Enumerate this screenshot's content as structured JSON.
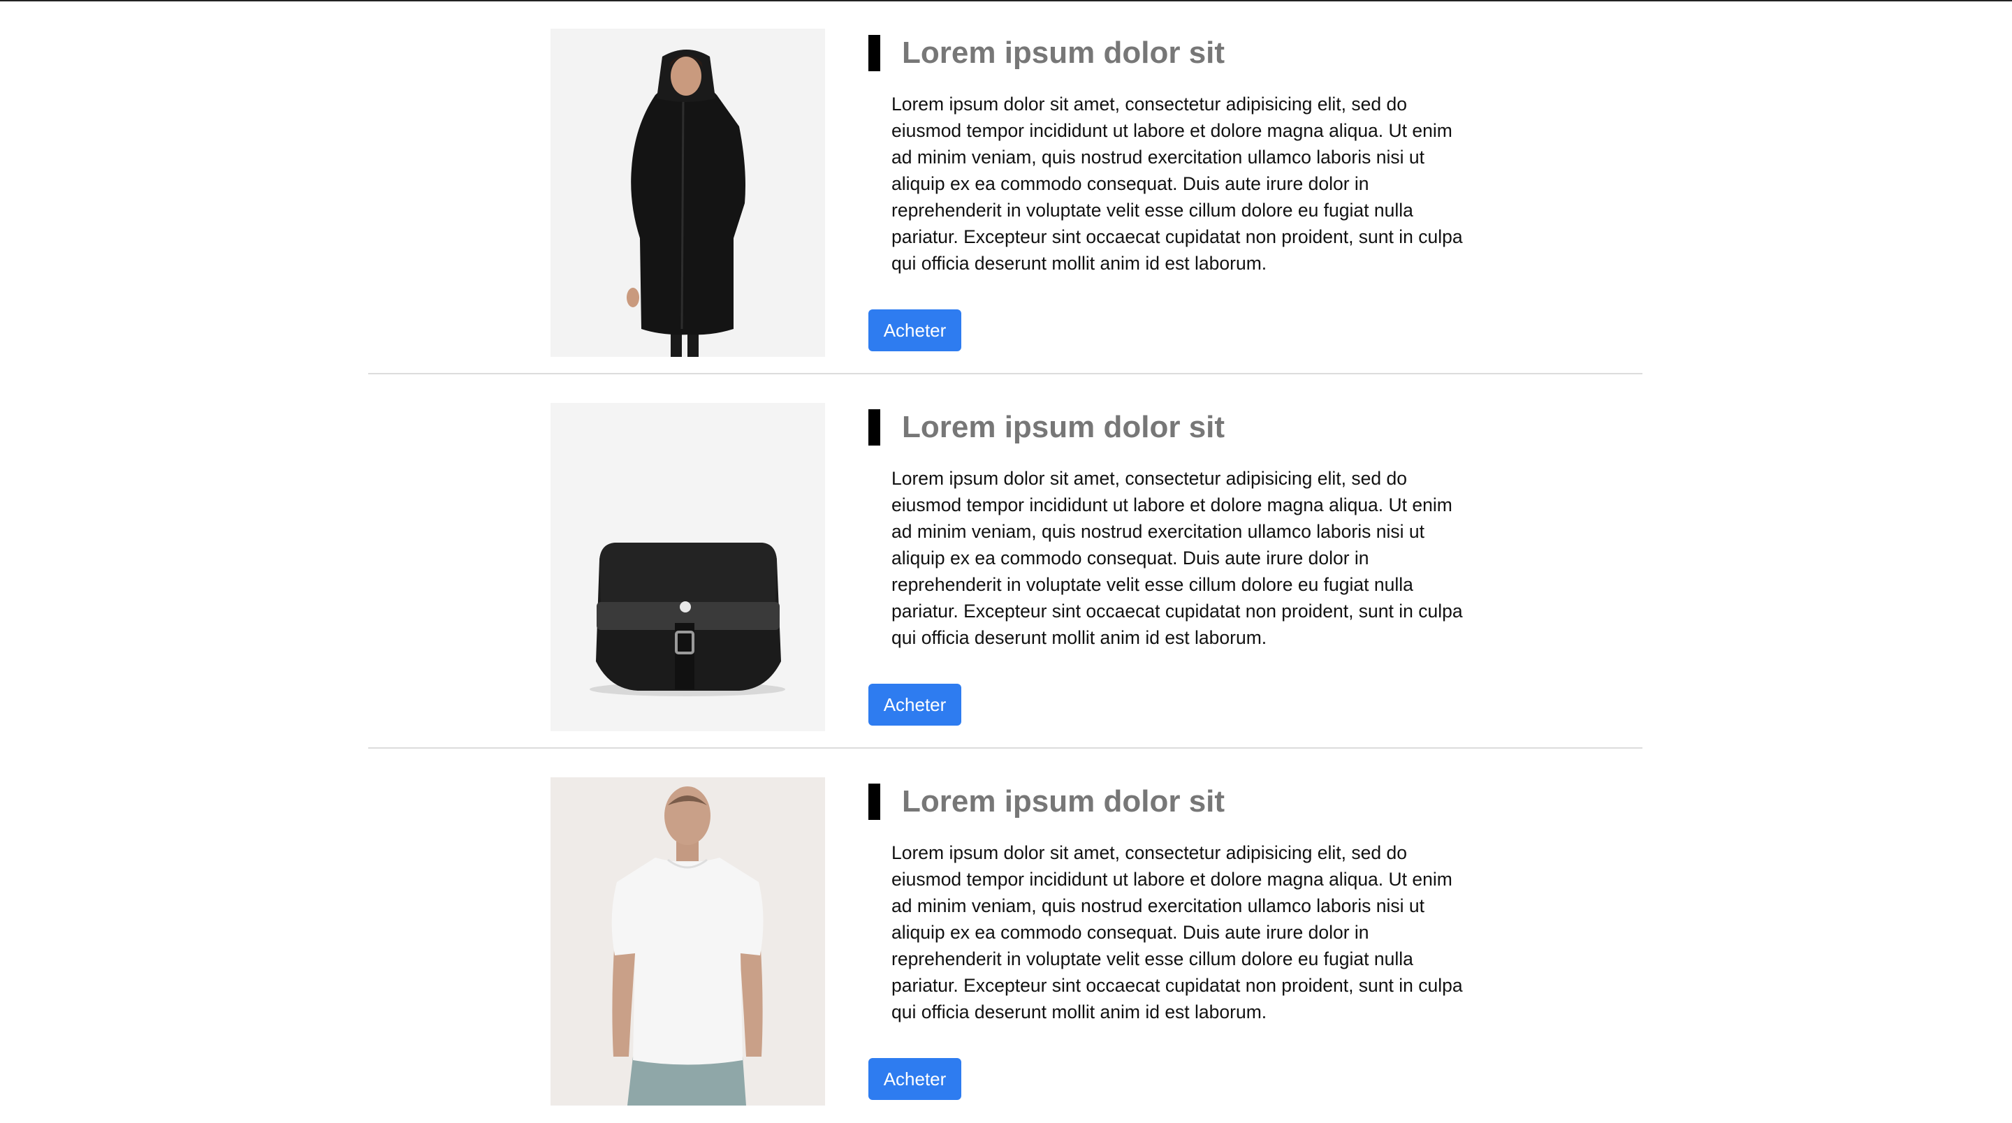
{
  "products": [
    {
      "image_icon": "black-hooded-coat-photo",
      "title": "Lorem ipsum dolor sit",
      "description": "Lorem ipsum dolor sit amet, consectetur adipisicing elit, sed do eiusmod tempor incididunt ut labore et dolore magna aliqua. Ut enim ad minim veniam, quis nostrud exercitation ullamco laboris nisi ut aliquip ex ea commodo consequat. Duis aute irure dolor in reprehenderit in voluptate velit esse cillum dolore eu fugiat nulla pariatur. Excepteur sint occaecat cupidatat non proident, sunt in culpa qui officia deserunt mollit anim id est laborum.",
      "button_label": "Acheter"
    },
    {
      "image_icon": "black-messenger-bag-photo",
      "title": "Lorem ipsum dolor sit",
      "description": "Lorem ipsum dolor sit amet, consectetur adipisicing elit, sed do eiusmod tempor incididunt ut labore et dolore magna aliqua. Ut enim ad minim veniam, quis nostrud exercitation ullamco laboris nisi ut aliquip ex ea commodo consequat. Duis aute irure dolor in reprehenderit in voluptate velit esse cillum dolore eu fugiat nulla pariatur. Excepteur sint occaecat cupidatat non proident, sunt in culpa qui officia deserunt mollit anim id est laborum.",
      "button_label": "Acheter"
    },
    {
      "image_icon": "white-tshirt-photo",
      "title": "Lorem ipsum dolor sit",
      "description": "Lorem ipsum dolor sit amet, consectetur adipisicing elit, sed do eiusmod tempor incididunt ut labore et dolore magna aliqua. Ut enim ad minim veniam, quis nostrud exercitation ullamco laboris nisi ut aliquip ex ea commodo consequat. Duis aute irure dolor in reprehenderit in voluptate velit esse cillum dolore eu fugiat nulla pariatur. Excepteur sint occaecat cupidatat non proident, sunt in culpa qui officia deserunt mollit anim id est laborum.",
      "button_label": "Acheter"
    }
  ],
  "colors": {
    "button": "#2e7cf0",
    "title": "#777777",
    "accent_bar": "#000000",
    "divider": "#dcdcdc"
  }
}
